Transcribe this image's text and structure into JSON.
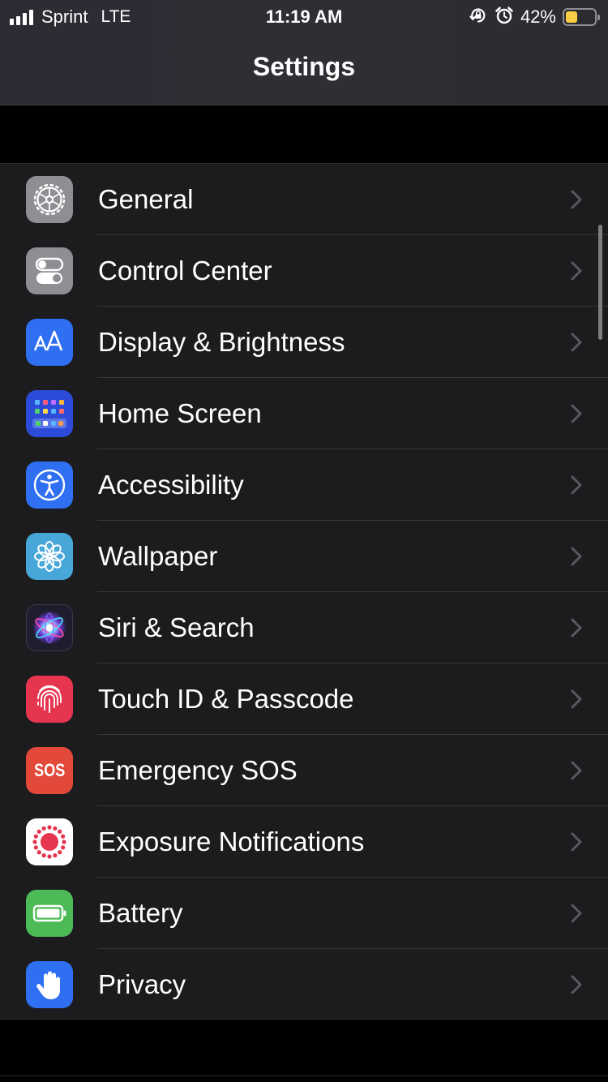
{
  "status": {
    "carrier": "Sprint",
    "network": "LTE",
    "time": "11:19 AM",
    "battery_percent": "42%",
    "battery_level": 0.42,
    "signal_bars": 4,
    "icons": [
      "orientation-lock-icon",
      "alarm-icon"
    ]
  },
  "nav": {
    "title": "Settings"
  },
  "colors": {
    "background": "#000000",
    "group_background": "#1c1c1e",
    "separator": "#38383a",
    "chevron": "#5a5a5e",
    "battery_fill": "#f7ce46"
  },
  "settings": {
    "items": [
      {
        "label": "General",
        "icon": "gear-icon",
        "color": "#8e8e93"
      },
      {
        "label": "Control Center",
        "icon": "toggles-icon",
        "color": "#8e8e93"
      },
      {
        "label": "Display & Brightness",
        "icon": "text-size-icon",
        "color": "#2f6ff2"
      },
      {
        "label": "Home Screen",
        "icon": "app-grid-icon",
        "color": "#2c4bd8"
      },
      {
        "label": "Accessibility",
        "icon": "accessibility-icon",
        "color": "#2f6ff2"
      },
      {
        "label": "Wallpaper",
        "icon": "flower-icon",
        "color": "#47a7d8"
      },
      {
        "label": "Siri & Search",
        "icon": "siri-icon",
        "color": "#1d1d2e"
      },
      {
        "label": "Touch ID & Passcode",
        "icon": "fingerprint-icon",
        "color": "#e5354f"
      },
      {
        "label": "Emergency SOS",
        "icon": "sos-icon",
        "color": "#e2493a"
      },
      {
        "label": "Exposure Notifications",
        "icon": "exposure-icon",
        "color": "#ffffff"
      },
      {
        "label": "Battery",
        "icon": "battery-icon",
        "color": "#4cba57"
      },
      {
        "label": "Privacy",
        "icon": "hand-icon",
        "color": "#2f6ff2"
      }
    ],
    "sos_text": "SOS"
  }
}
